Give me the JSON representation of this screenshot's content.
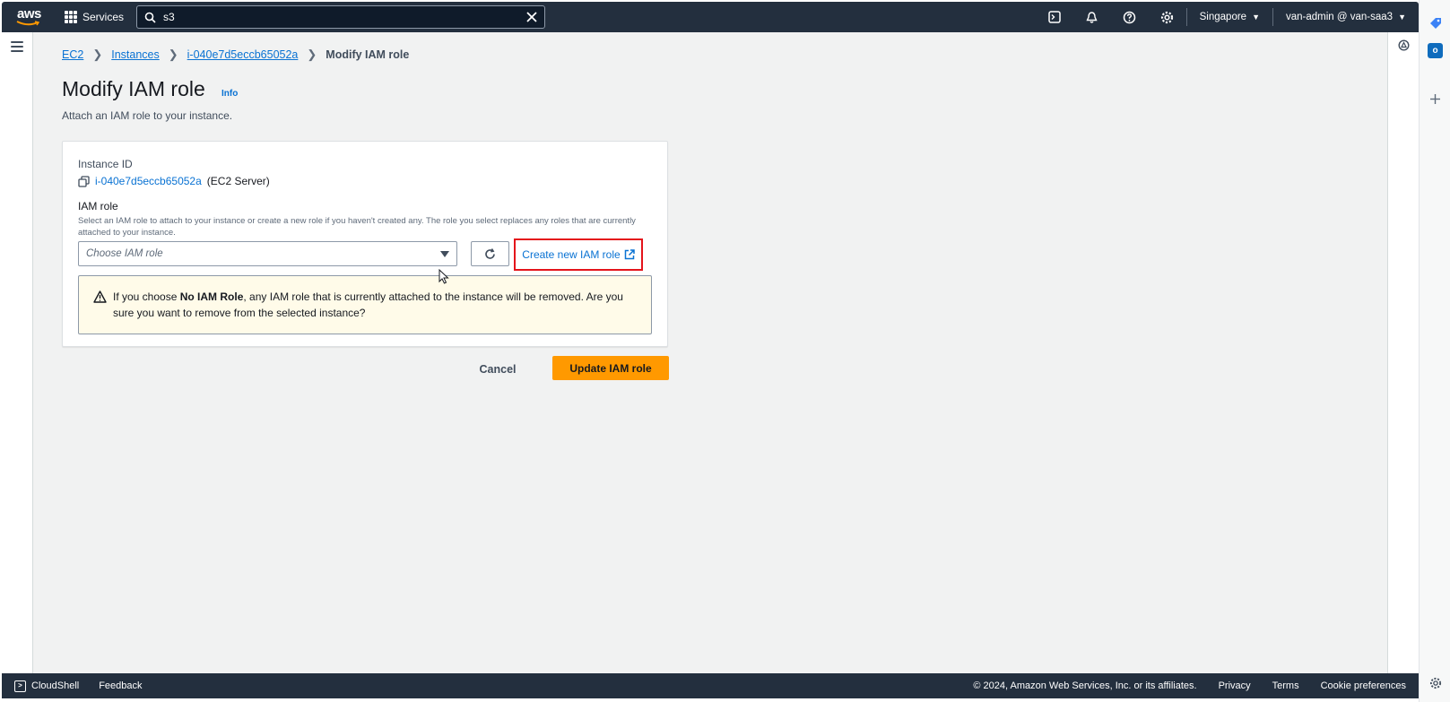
{
  "topnav": {
    "logo_text": "aws",
    "services_label": "Services",
    "search_value": "s3",
    "region_label": "Singapore",
    "account_label": "van-admin @ van-saa3"
  },
  "breadcrumb": {
    "items": [
      "EC2",
      "Instances",
      "i-040e7d5eccb65052a"
    ],
    "current": "Modify IAM role"
  },
  "page": {
    "title": "Modify IAM role",
    "info_label": "Info",
    "subtitle": "Attach an IAM role to your instance."
  },
  "form": {
    "instance_id_label": "Instance ID",
    "instance_id_value": "i-040e7d5eccb65052a",
    "instance_name": "(EC2 Server)",
    "iam_role_label": "IAM role",
    "iam_role_description": "Select an IAM role to attach to your instance or create a new role if you haven't created any. The role you select replaces any roles that are currently attached to your instance.",
    "iam_role_placeholder": "Choose IAM role",
    "create_role_link": "Create new IAM role",
    "warning_prefix": "If you choose ",
    "warning_bold": "No IAM Role",
    "warning_suffix": ", any IAM role that is currently attached to the instance will be removed. Are you sure you want to remove from the selected instance?"
  },
  "actions": {
    "cancel_label": "Cancel",
    "update_label": "Update IAM role"
  },
  "footer": {
    "cloudshell_label": "CloudShell",
    "feedback_label": "Feedback",
    "copyright": "© 2024, Amazon Web Services, Inc. or its affiliates.",
    "privacy_label": "Privacy",
    "terms_label": "Terms",
    "cookie_label": "Cookie preferences"
  },
  "colors": {
    "nav_bg": "#232f3e",
    "link": "#0972d3",
    "primary_button": "#ff9900",
    "highlight_box": "#e4141b",
    "warning_bg": "#fffbe9"
  }
}
